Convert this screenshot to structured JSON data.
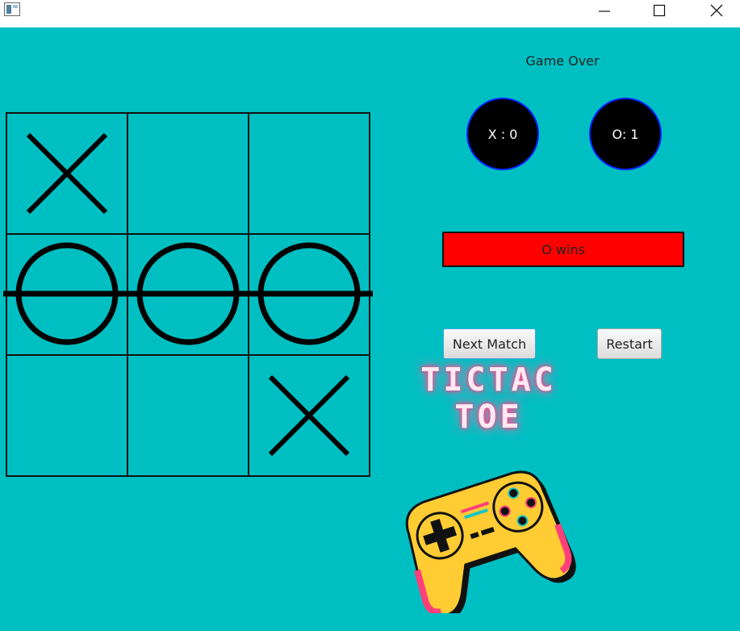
{
  "window": {
    "minimize_label": "—",
    "maximize_label": "☐",
    "close_label": "✕"
  },
  "game": {
    "status": "Game Over",
    "board": [
      "X",
      "",
      "",
      "O",
      "O",
      "O",
      "",
      "",
      "X"
    ],
    "winning_line": "middle-row"
  },
  "score": {
    "x": "X : 0",
    "o": "O: 1"
  },
  "result": {
    "text": "O wins",
    "color": "#ff0000"
  },
  "buttons": {
    "next": "Next Match",
    "restart": "Restart"
  },
  "logo": {
    "line1": "TICTAC",
    "line2": "TOE"
  },
  "colors": {
    "background": "#00bfc2",
    "accent": "#0a22ff",
    "logo_glow": "#ff3f8a"
  }
}
